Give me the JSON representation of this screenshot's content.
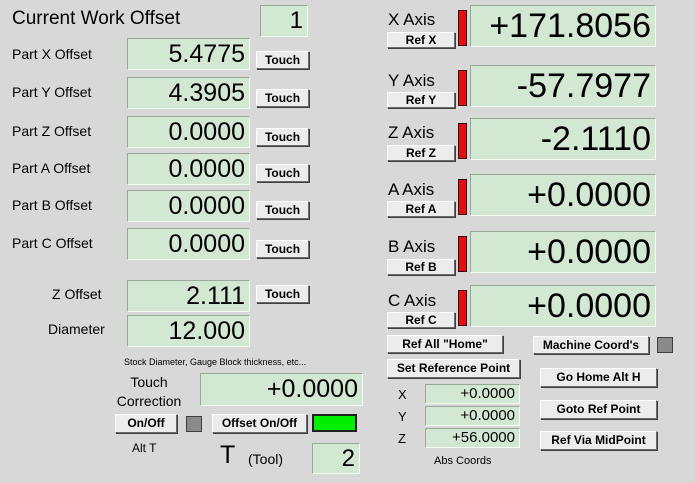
{
  "work_offset": {
    "title": "Current Work Offset",
    "value": "1"
  },
  "parts": [
    {
      "label": "Part X Offset",
      "value": "5.4775",
      "touch": "Touch"
    },
    {
      "label": "Part Y Offset",
      "value": "4.3905",
      "touch": "Touch"
    },
    {
      "label": "Part Z Offset",
      "value": "0.0000",
      "touch": "Touch"
    },
    {
      "label": "Part A Offset",
      "value": "0.0000",
      "touch": "Touch"
    },
    {
      "label": "Part B Offset",
      "value": "0.0000",
      "touch": "Touch"
    },
    {
      "label": "Part C Offset",
      "value": "0.0000",
      "touch": "Touch"
    }
  ],
  "z_offset": {
    "label": "Z Offset",
    "value": "2.111",
    "touch": "Touch"
  },
  "diameter": {
    "label": "Diameter",
    "value": "12.000"
  },
  "note": "Stock Diameter, Gauge Block thickness, etc...",
  "touch_correction": {
    "label_line1": "Touch",
    "label_line2": "Correction",
    "value": "+0.0000"
  },
  "onoff_button": "On/Off",
  "offset_onoff_button": "Offset On/Off",
  "alt_t": "Alt T",
  "tool": {
    "letter": "T",
    "label": "(Tool)",
    "value": "2"
  },
  "axes": [
    {
      "label": "X Axis",
      "ref": "Ref X",
      "value": "+171.8056"
    },
    {
      "label": "Y Axis",
      "ref": "Ref Y",
      "value": "-57.7977"
    },
    {
      "label": "Z Axis",
      "ref": "Ref Z",
      "value": "-2.1110"
    },
    {
      "label": "A Axis",
      "ref": "Ref A",
      "value": "+0.0000"
    },
    {
      "label": "B Axis",
      "ref": "Ref B",
      "value": "+0.0000"
    },
    {
      "label": "C Axis",
      "ref": "Ref C",
      "value": "+0.0000"
    }
  ],
  "ref_all_home": "Ref All \"Home\"",
  "machine_coords": "Machine Coord's",
  "set_reference_point": "Set Reference Point",
  "abs_coords": [
    {
      "label": "X",
      "value": "+0.0000"
    },
    {
      "label": "Y",
      "value": "+0.0000"
    },
    {
      "label": "Z",
      "value": "+56.0000"
    }
  ],
  "abs_coords_label": "Abs Coords",
  "go_home_alt_h": "Go Home Alt H",
  "goto_ref_point": "Goto Ref Point",
  "ref_via_midpoint": "Ref Via MidPoint",
  "colors": {
    "background": "#d8d8d8",
    "dro": "#d3e8d3",
    "led_red": "#e01010",
    "led_green": "#00ee00"
  }
}
